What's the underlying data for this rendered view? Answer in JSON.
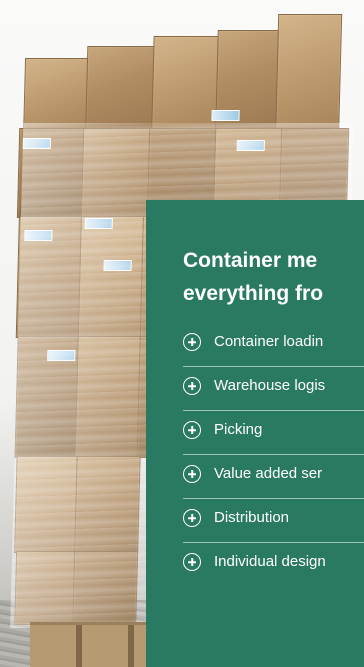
{
  "panel": {
    "title_line1": "Container me",
    "title_line2": "everything fro",
    "accent_color": "#2a7a63"
  },
  "services": [
    {
      "label": "Container loadin",
      "icon": "plus-circle-icon"
    },
    {
      "label": "Warehouse logis",
      "icon": "plus-circle-icon"
    },
    {
      "label": "Picking",
      "icon": "plus-circle-icon"
    },
    {
      "label": "Value added ser",
      "icon": "plus-circle-icon"
    },
    {
      "label": "Distribution",
      "icon": "plus-circle-icon"
    },
    {
      "label": "Individual design",
      "icon": "plus-circle-icon"
    }
  ]
}
